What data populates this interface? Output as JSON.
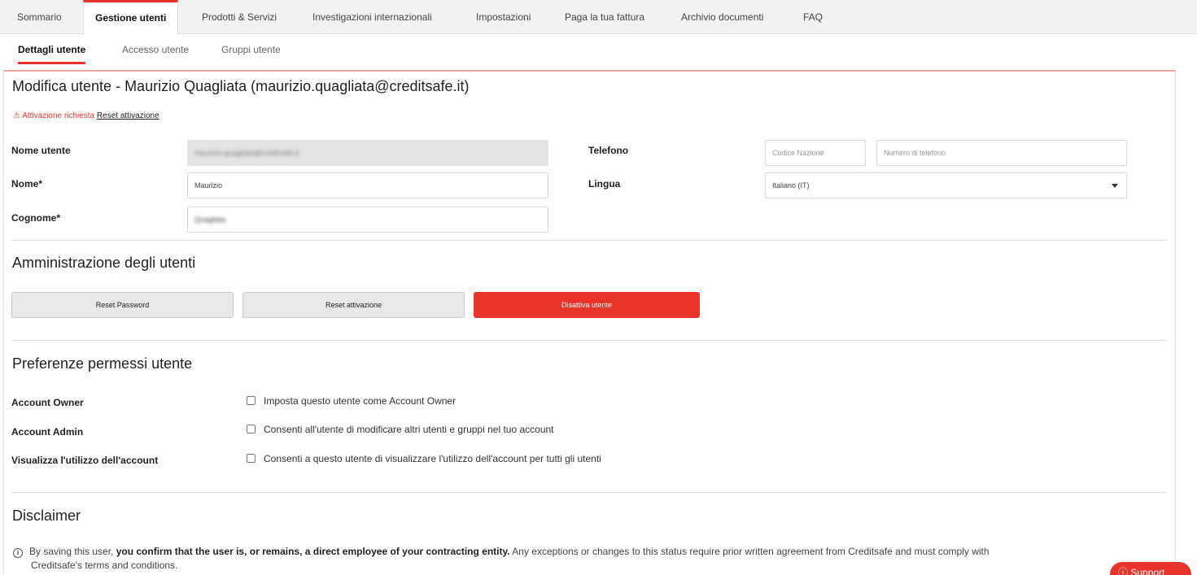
{
  "top_nav": {
    "tabs": [
      {
        "label": "Sommario"
      },
      {
        "label": "Gestione utenti",
        "active": true
      },
      {
        "label": "Prodotti & Servizi"
      },
      {
        "label": "Investigazioni internazionali"
      },
      {
        "label": "Impostazioni"
      },
      {
        "label": "Paga la tua fattura"
      },
      {
        "label": "Archivio documenti"
      },
      {
        "label": "FAQ"
      }
    ]
  },
  "sub_nav": {
    "tabs": [
      {
        "label": "Dettagli utente",
        "active": true
      },
      {
        "label": "Accesso utente"
      },
      {
        "label": "Gruppi utente"
      }
    ]
  },
  "page": {
    "title": "Modifica utente - Maurizio Quagliata (maurizio.quagliata@creditsafe.it)",
    "warning": {
      "icon": "warning-triangle-icon",
      "text": "Attivazione richiesta",
      "link": "Reset attivazione"
    }
  },
  "form": {
    "username_label": "Nome utente",
    "username_value": "maurizio.quagliata@creditsafe.it",
    "firstname_label": "Nome*",
    "firstname_value": "Maurizio",
    "lastname_label": "Cognome*",
    "lastname_value": "Quagliata",
    "phone_label": "Telefono",
    "phone_country_placeholder": "Codice Nazione",
    "phone_number_placeholder": "Numero di telefono",
    "language_label": "Lingua",
    "language_value": "Italiano (IT)"
  },
  "admin": {
    "heading": "Amministrazione degli utenti",
    "reset_password": "Reset Password",
    "reset_activation": "Reset attivazione",
    "deactivate": "Disattiva utente"
  },
  "permissions": {
    "heading": "Preferenze permessi utente",
    "rows": [
      {
        "label": "Account Owner",
        "text": "Imposta questo utente come Account Owner",
        "checked": false
      },
      {
        "label": "Account Admin",
        "text": "Consenti all'utente di modificare altri utenti e gruppi nel tuo account",
        "checked": false
      },
      {
        "label": "Visualizza l'utilizzo dell'account",
        "text": "Consenti a questo utente di visualizzare l'utilizzo dell'account per tutti gli utenti",
        "checked": false
      }
    ]
  },
  "disclaimer": {
    "heading": "Disclaimer",
    "text_pre": "By saving this user, ",
    "text_bold": "you confirm that the user is, or remains, a direct employee of your contracting entity.",
    "text_post": " Any exceptions or changes to this status require prior written agreement from Creditsafe and must comply with",
    "text_line2": "Creditsafe's terms and conditions."
  },
  "support": {
    "label": "Support",
    "icon": "help-circle-icon"
  },
  "colors": {
    "accent": "#e8342a",
    "nav_bg": "#f2f2f2"
  }
}
